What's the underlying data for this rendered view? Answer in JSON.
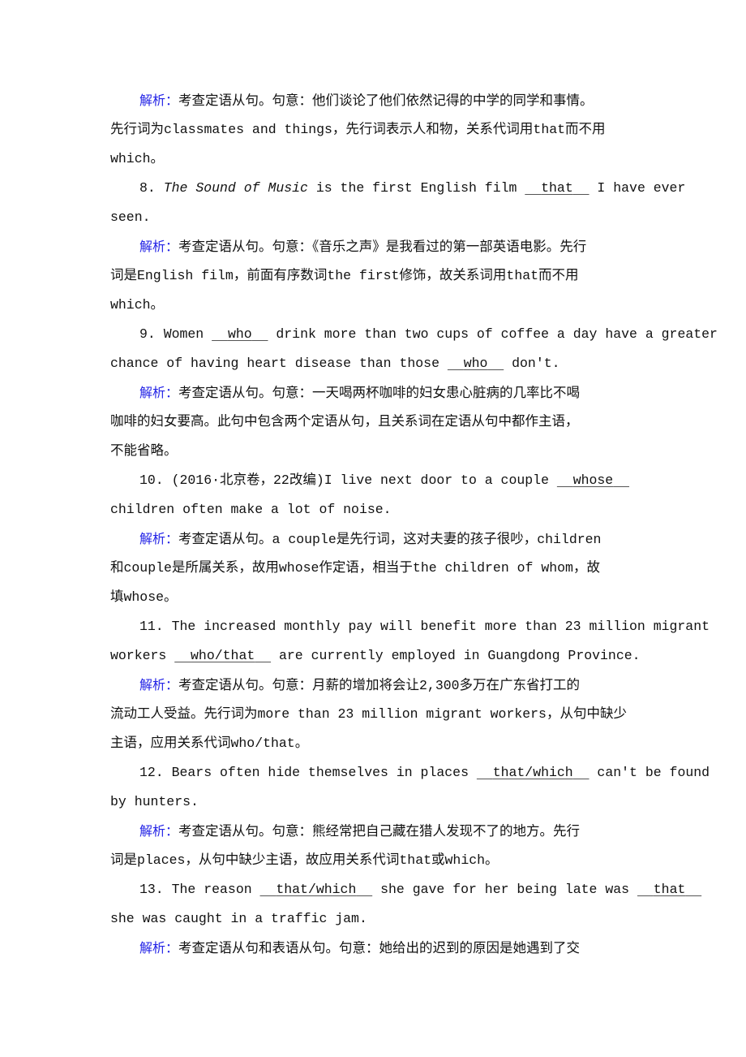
{
  "label": "解析：",
  "q7": {
    "analysis": [
      "考查定语从句。句意：他们谈论了他们依然记得的中学的同学和事情。",
      "先行词为classmates and things，先行词表示人和物，关系代词用that而不用",
      "which。"
    ]
  },
  "q8": {
    "num": "8. ",
    "title": "The Sound of Music",
    "pre": " is the first English film ",
    "blank": "that",
    "post": " I have ever",
    "line2": "seen.",
    "analysis": [
      "考查定语从句。句意：《音乐之声》是我看过的第一部英语电影。先行",
      "词是English film，前面有序数词the first修饰，故关系词用that而不用",
      "which。"
    ]
  },
  "q9": {
    "num": "9. Women ",
    "blank1": "who",
    "mid1": " drink more than two cups of coffee a day have a greater",
    "line2pre": "chance of having heart disease than those ",
    "blank2": "who",
    "line2post": " don't.",
    "analysis": [
      "考查定语从句。句意：一天喝两杯咖啡的妇女患心脏病的几率比不喝",
      "咖啡的妇女要高。此句中包含两个定语从句，且关系词在定语从句中都作主语，",
      "不能省略。"
    ]
  },
  "q10": {
    "num": "10. (2016·北京卷，22改编)I live next door to a couple ",
    "blank": "whose",
    "line2": "children often make a lot of noise.",
    "analysis": [
      "考查定语从句。a couple是先行词，这对夫妻的孩子很吵，children",
      "和couple是所属关系，故用whose作定语，相当于the children of whom，故",
      "填whose。"
    ]
  },
  "q11": {
    "line1": "11. The increased monthly pay will benefit more than 23 million migrant",
    "line2pre": "workers ",
    "blank": "who/that",
    "line2post": " are currently employed in Guangdong Province.",
    "analysis": [
      "考查定语从句。句意：月薪的增加将会让2,300多万在广东省打工的",
      "流动工人受益。先行词为more than 23 million migrant workers，从句中缺少",
      "主语，应用关系代词who/that。"
    ]
  },
  "q12": {
    "pre": "12. Bears often hide themselves in places ",
    "blank": "that/which",
    "post": " can't be found",
    "line2": "by hunters.",
    "analysis": [
      "考查定语从句。句意：熊经常把自己藏在猎人发现不了的地方。先行",
      "词是places，从句中缺少主语，故应用关系代词that或which。"
    ]
  },
  "q13": {
    "pre": "13. The reason ",
    "blank1": "that/which",
    "mid": " she gave for her being late was ",
    "blank2": "that",
    "line2": "she was caught in a traffic jam.",
    "analysis": [
      "考查定语从句和表语从句。句意：她给出的迟到的原因是她遇到了交"
    ]
  }
}
